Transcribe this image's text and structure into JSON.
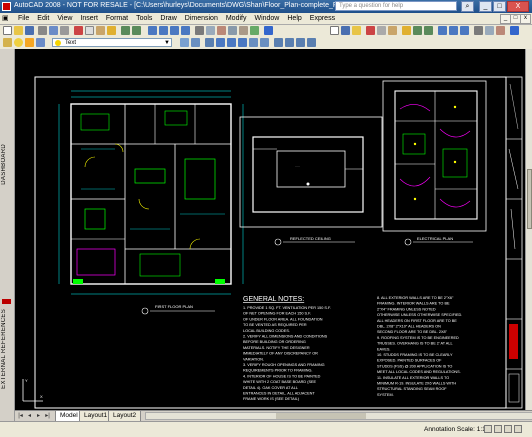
{
  "window": {
    "title": "AutoCAD 2008 - NOT FOR RESALE - [C:\\Users\\hurleys\\Documents\\DWG\\Shan\\Floor_Plan-complete_FLOOR PLAN.dwg]",
    "search_placeholder": "Type a question for help",
    "minimize": "_",
    "restore": "□",
    "close": "X"
  },
  "menu": {
    "items": [
      "File",
      "Edit",
      "View",
      "Insert",
      "Format",
      "Tools",
      "Draw",
      "Dimension",
      "Modify",
      "Window",
      "Help",
      "Express"
    ]
  },
  "layer_toolbar": {
    "current_layer": "Text"
  },
  "side_panels": {
    "dashboard": "DASHBOARD",
    "external_references": "EXTERNAL REFERENCES"
  },
  "drawing": {
    "first_floor_title": "FIRST FLOOR PLAN",
    "reflected_ceiling_title": "REFLECTED CEILING",
    "electrical_plan_title": "ELECTRICAL PLAN",
    "notes_heading": "GENERAL NOTES:",
    "notes_left": [
      "1.  PROVIDE 1 SQ. FT. VENTILATION PER 150 S.F.",
      "    OF NET OPENING FOR EACH 150 S.F.",
      "    OF UNDER FLOOR AREA. ALL FOUNDATION",
      "    TO BE VENTED AS REQUIRED PER",
      "    LOCAL BUILDING CODES.",
      "2.  VERIFY ALL DIMENSIONS AND CONDITIONS",
      "    BEFORE BUILDING OR ORDERING",
      "    MATERIALS. NOTIFY THE DESIGNER",
      "    IMMEDIATELY OF ANY DISCREPANCY OR",
      "    VARIATION.",
      "3.  VERIFY ROUGH OPENINGS AND FRAMING",
      "    REQUIREMENTS PRIOR TO FRAMING.",
      "4.  INTERIOR OF HOUSE IS TO BE PAINTED",
      "    WHITE WITH 2 COAT BASE BOARD (SEE",
      "    DETAIL 4). OAK COVER AT ALL",
      "    ENTRANCES IN DETAIL. ALL ADJACENT",
      "    FRAME WORK IS (SEE DETAIL)"
    ],
    "notes_right": [
      "8.  ALL EXTERIOR WALLS ARE TO BE 2\"X6\"",
      "    FRAMING. INTERIOR WALLS ARE TO BE",
      "    2\"X4\" FRAMING UNLESS NOTED",
      "    OTHERWISE UNLESS OTHERWISE SPECIFIED.",
      "    ALL HEADERS ON FIRST FLOOR ARE TO BE",
      "    DBL. 2X8\" 2\"X10\" ALL HEADERS ON",
      "    SECOND FLOOR ARE TO BE DBL. 2X8\"",
      "9.  ROOFING SYSTEM IS TO BE ENGINEERED",
      "    TRUSSES. OVERHANG IS TO BE 2' AT ALL",
      "    EAVES.",
      "10. STUDDS FRAMING IS TO BE CLEARLY",
      "    EXPOSED. PAINTED SURFACES OF",
      "    STUDDS (FSS) @ 200 APPLICATION IS TO",
      "    MEET ALL LOCAL CODES AND REGULATIONS.",
      "11. INSULATE ALL EXTERIOR WALLS TO",
      "    MINIMUM R-19. INSULATE 2X6 WALLS WITH",
      "    STRUCTURAL STANDING SEAM ROOF",
      "    SYSTEM."
    ]
  },
  "layout_tabs": {
    "model": "Model",
    "layout1": "Layout1",
    "layout2": "Layout2"
  },
  "status": {
    "annotation_scale_label": "Annotation Scale:",
    "annotation_scale_value": "1:1"
  }
}
